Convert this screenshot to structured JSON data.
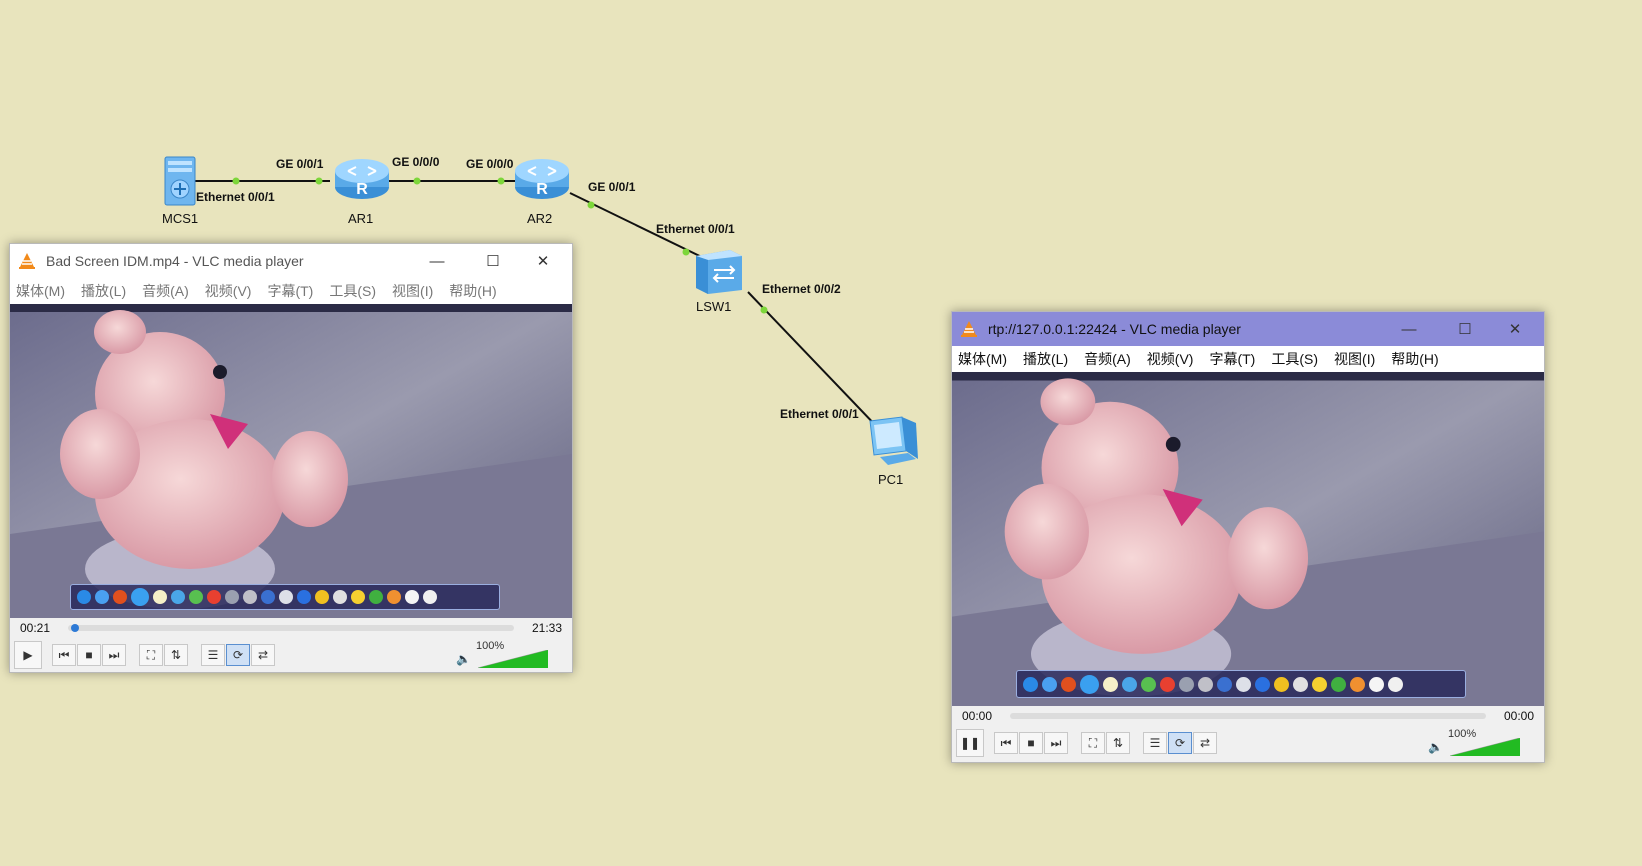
{
  "topology": {
    "devices": [
      {
        "name": "MCS1",
        "kind": "server"
      },
      {
        "name": "AR1",
        "kind": "router"
      },
      {
        "name": "AR2",
        "kind": "router"
      },
      {
        "name": "LSW1",
        "kind": "switch"
      },
      {
        "name": "PC1",
        "kind": "pc"
      }
    ],
    "port_labels": {
      "mcs1_eth": "Ethernet 0/0/1",
      "ar1_ge1": "GE 0/0/1",
      "ar1_ge0": "GE 0/0/0",
      "ar2_ge0": "GE 0/0/0",
      "ar2_ge1": "GE 0/0/1",
      "lsw1_eth1": "Ethernet 0/0/1",
      "lsw1_eth2": "Ethernet 0/0/2",
      "pc1_eth": "Ethernet 0/0/1"
    }
  },
  "colors": {
    "canvas_bg": "#e8e4bd",
    "link": "#111111",
    "port_dot": "#7dd63a",
    "active_titlebar": "#8b8bd8",
    "vlc_orange": "#f28a1a",
    "volume_green": "#22bb22"
  },
  "vlc_windows": [
    {
      "title": "Bad Screen IDM.mp4 - VLC media player",
      "active": false,
      "menu": [
        "媒体(M)",
        "播放(L)",
        "音频(A)",
        "视频(V)",
        "字幕(T)",
        "工具(S)",
        "视图(I)",
        "帮助(H)"
      ],
      "time_elapsed": "00:21",
      "time_total": "21:33",
      "progress_fraction": 0.016,
      "play_state": "paused",
      "volume_label": "100%",
      "volume_fraction": 1.0,
      "controls": [
        "play-icon",
        "prev-icon",
        "stop-icon",
        "next-icon",
        "fullscreen-icon",
        "extended-icon",
        "playlist-icon",
        "loop-icon",
        "shuffle-icon"
      ]
    },
    {
      "title": "rtp://127.0.0.1:22424 - VLC media player",
      "active": true,
      "menu": [
        "媒体(M)",
        "播放(L)",
        "音频(A)",
        "视频(V)",
        "字幕(T)",
        "工具(S)",
        "视图(I)",
        "帮助(H)"
      ],
      "time_elapsed": "00:00",
      "time_total": "00:00",
      "progress_fraction": 0.0,
      "play_state": "playing",
      "volume_label": "100%",
      "volume_fraction": 1.0,
      "controls": [
        "pause-icon",
        "prev-icon",
        "stop-icon",
        "next-icon",
        "fullscreen-icon",
        "extended-icon",
        "playlist-icon",
        "loop-icon",
        "shuffle-icon"
      ]
    }
  ]
}
